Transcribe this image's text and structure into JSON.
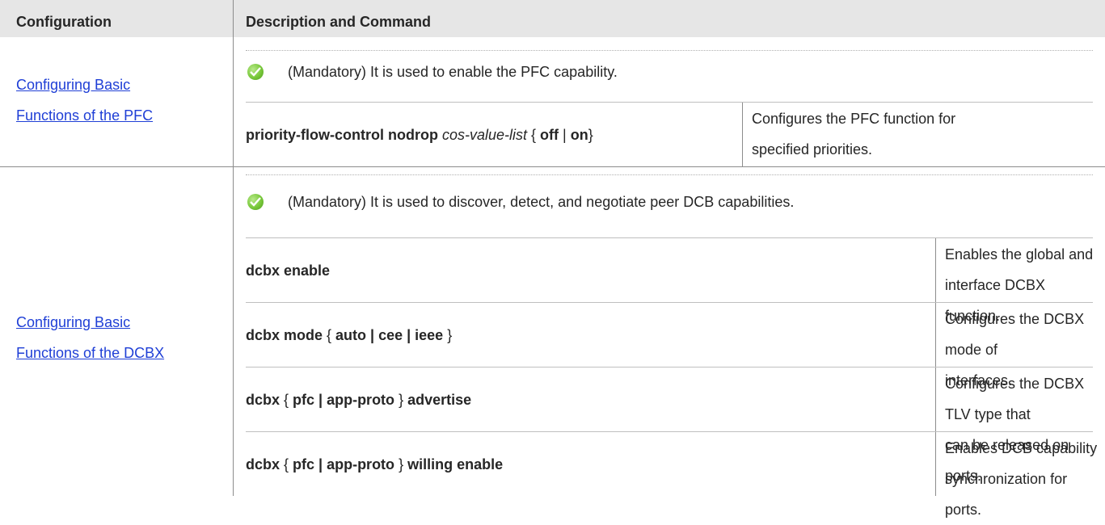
{
  "header": {
    "col1": "Configuration",
    "col2": "Description and Command"
  },
  "sections": [
    {
      "link_line1": "Configuring Basic ",
      "link_line2": "Functions of the PFC",
      "note": "(Mandatory) It is used to enable the PFC capability.",
      "rows": [
        {
          "cmd": {
            "kw1": "priority-flow-control nodrop",
            "arg": "cos-value-list",
            "brace_open": " { ",
            "off": "off",
            "pipe": " | ",
            "on": "on",
            "brace_close": "}"
          },
          "desc_line1": "Configures the PFC function for",
          "desc_line2": "specified priorities."
        }
      ]
    },
    {
      "link_line1": "Configuring Basic ",
      "link_line2": "Functions of the DCBX",
      "note": "(Mandatory) It is used to discover, detect, and negotiate peer DCB capabilities.",
      "rows": [
        {
          "cmd": {
            "kw1": "dcbx enable"
          },
          "desc_line1": "Enables the global and interface DCBX",
          "desc_line2": "function."
        },
        {
          "cmd": {
            "kw1": "dcbx mode",
            "brace_open": " { ",
            "opts": "auto | cee | ieee",
            "brace_close": " }"
          },
          "desc_line1": "Configures the DCBX mode of",
          "desc_line2": "interfaces."
        },
        {
          "cmd": {
            "kw1": "dcbx",
            "brace_open": " { ",
            "opts": "pfc | app-proto",
            "brace_close": " } ",
            "kw2": "advertise"
          },
          "desc_line1": "Configures the DCBX TLV type that",
          "desc_line2": "can be released on ports."
        },
        {
          "cmd": {
            "kw1": "dcbx",
            "brace_open": " { ",
            "opts": "pfc | app-proto",
            "brace_close": " } ",
            "kw2": "willing enable"
          },
          "desc_line1": "Enables DCB capability",
          "desc_line2": "synchronization for ports."
        }
      ]
    }
  ],
  "colors": {
    "header_bg": "#e6e6e6",
    "link": "#1f3fd6",
    "check_green": "#78c83a",
    "border": "#8c8c8c"
  },
  "icons": [
    "check-circle-icon"
  ]
}
